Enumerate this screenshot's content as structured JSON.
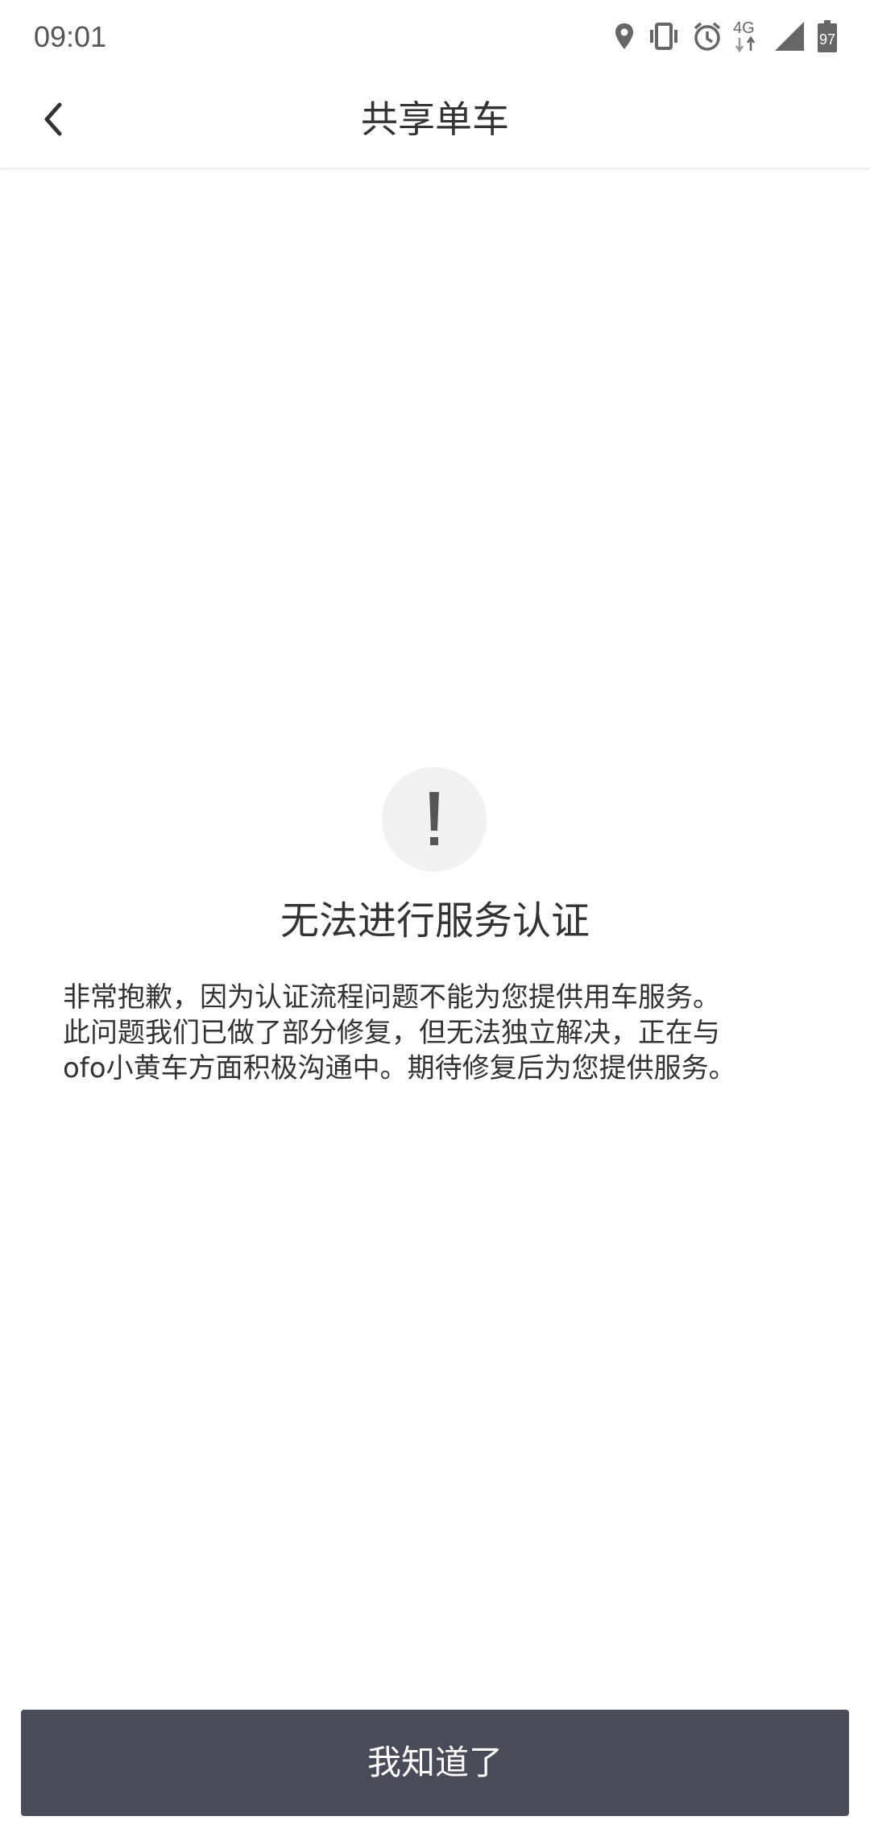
{
  "status_bar": {
    "time": "09:01",
    "network": "4G",
    "battery": "97",
    "icons": [
      "location-icon",
      "vibrate-icon",
      "alarm-icon",
      "network-4g-icon",
      "signal-icon",
      "battery-icon"
    ]
  },
  "nav": {
    "title": "共享单车",
    "back_icon": "chevron-left-icon"
  },
  "alert": {
    "icon": "exclamation-icon",
    "symbol": "!",
    "title": "无法进行服务认证",
    "message": "非常抱歉，因为认证流程问题不能为您提供用车服务。\n此问题我们已做了部分修复，但无法独立解决，正在与\nofo小黄车方面积极沟通中。期待修复后为您提供服务。"
  },
  "actions": {
    "confirm_label": "我知道了"
  },
  "colors": {
    "button_bg": "#4a4b59",
    "icon_circle_bg": "#f0f1f3",
    "text": "#333333"
  }
}
